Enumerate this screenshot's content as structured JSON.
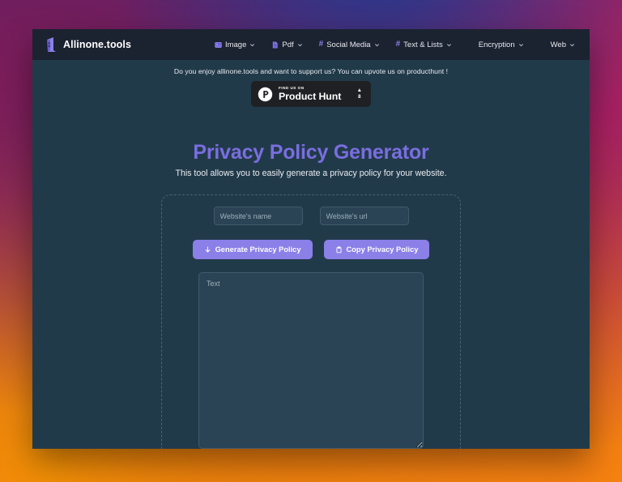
{
  "brand": {
    "name": "Allinone.tools",
    "logo_icon": "tower-logo-icon"
  },
  "nav": {
    "items": [
      {
        "label": "Image",
        "icon": "image-icon",
        "caret": "chevron-down-icon"
      },
      {
        "label": "Pdf",
        "icon": "file-icon",
        "caret": "chevron-down-icon"
      },
      {
        "label": "Social Media",
        "icon": "hash-icon",
        "caret": "chevron-down-icon"
      },
      {
        "label": "Text & Lists",
        "icon": "hash-icon",
        "caret": "chevron-down-icon"
      },
      {
        "label": "Encryption",
        "icon": "link-icon",
        "caret": "chevron-down-icon"
      },
      {
        "label": "Web",
        "icon": "link-icon",
        "caret": "chevron-down-icon"
      }
    ]
  },
  "promo": {
    "message": "Do you enjoy allinone.tools and want to support us? You can upvote us on producthunt !",
    "badge": {
      "find_us_on": "FIND US ON",
      "name": "Product Hunt",
      "upvote_arrow": "▲",
      "upvote_count": "8",
      "logo_icon": "product-hunt-icon"
    }
  },
  "page": {
    "title": "Privacy Policy Generator",
    "subtitle": "This tool allows you to easily generate a privacy policy for your website."
  },
  "form": {
    "website_name": {
      "value": "",
      "placeholder": "Website's name"
    },
    "website_url": {
      "value": "",
      "placeholder": "Website's url"
    },
    "generate_button": {
      "label": "Generate Privacy Policy",
      "icon": "download-arrow-icon"
    },
    "copy_button": {
      "label": "Copy Privacy Policy",
      "icon": "clipboard-icon"
    },
    "output": {
      "value": "",
      "placeholder": "Text"
    }
  },
  "colors": {
    "accent_purple": "#8b7fe8",
    "title_purple": "#7a6ee0",
    "page_bg": "#213a49",
    "navbar_bg": "#1b2230",
    "input_bg": "#2a4455",
    "badge_bg": "#1f2024"
  }
}
